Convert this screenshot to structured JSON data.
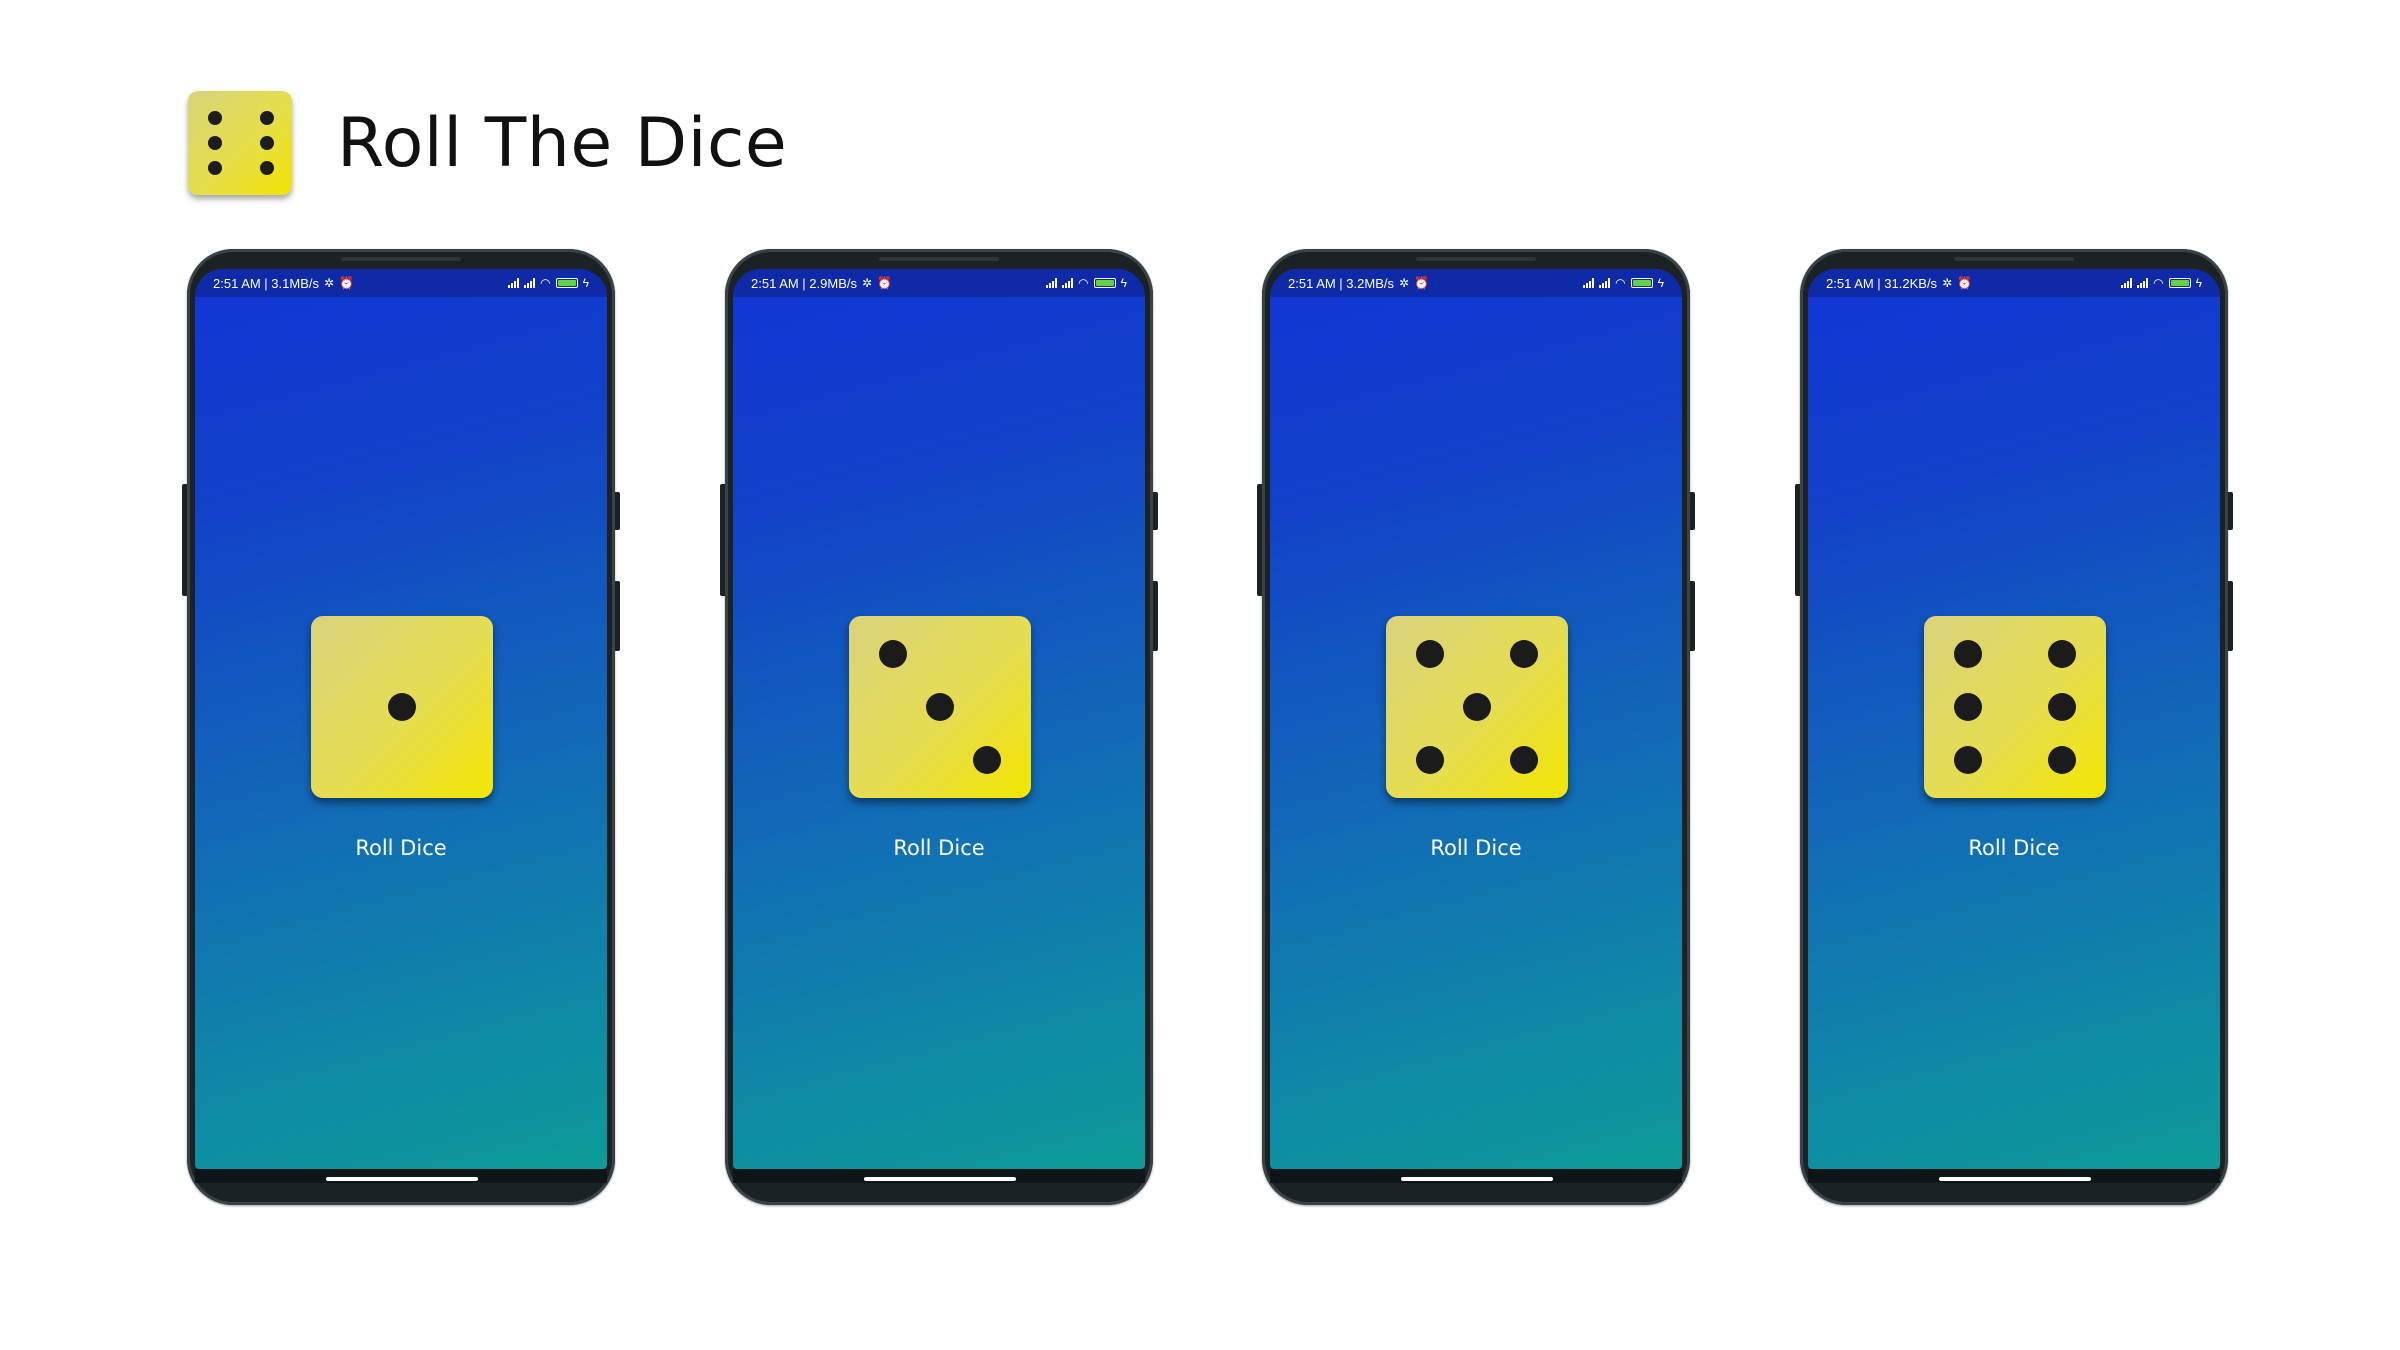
{
  "header": {
    "title": "Roll The Dice",
    "logo_icon": "dice-six-icon",
    "logo_face": 6
  },
  "colors": {
    "die_yellow": "#f2e400",
    "pip": "#1b1b1b",
    "gradient_top": "#1235d6",
    "gradient_bottom": "#0d9b98",
    "statusbar": "#0e2aa8"
  },
  "phones": [
    {
      "status": {
        "time_speed": "2:51 AM | 3.1MB/s",
        "battery": "100"
      },
      "die_face": 1,
      "button_label": "Roll Dice"
    },
    {
      "status": {
        "time_speed": "2:51 AM | 2.9MB/s",
        "battery": "100"
      },
      "die_face": 3,
      "button_label": "Roll Dice"
    },
    {
      "status": {
        "time_speed": "2:51 AM | 3.2MB/s",
        "battery": "100"
      },
      "die_face": 5,
      "button_label": "Roll Dice"
    },
    {
      "status": {
        "time_speed": "2:51 AM | 31.2KB/s",
        "battery": "100"
      },
      "die_face": 6,
      "button_label": "Roll Dice"
    }
  ]
}
